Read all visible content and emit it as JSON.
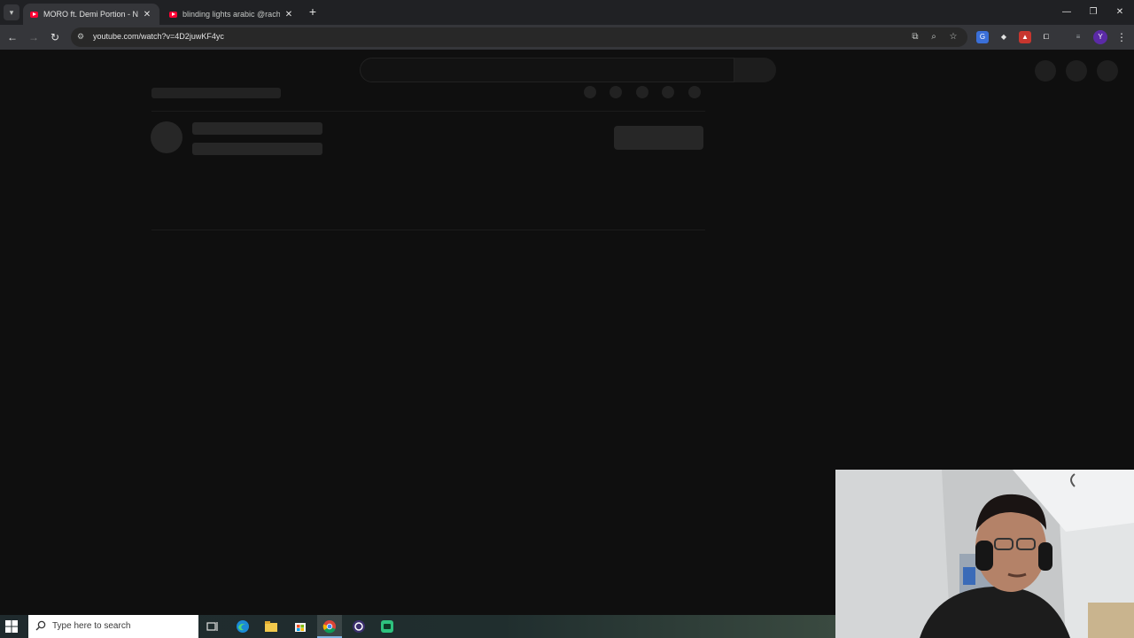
{
  "browser": {
    "tabs": [
      {
        "title": "MORO ft. Demi Portion - NINJA",
        "active": true,
        "close": "✕"
      },
      {
        "title": "blinding lights arabic @rachida",
        "active": false,
        "close": "✕"
      }
    ],
    "new_tab": "+",
    "window_controls": {
      "minimize": "—",
      "restore": "❐",
      "close": "✕"
    },
    "nav": {
      "back": "←",
      "forward": "→",
      "reload": "↻"
    },
    "url": "youtube.com/watch?v=4D2juwKF4yc",
    "profile_initial": "Y",
    "menu": "⋮"
  },
  "taskbar": {
    "search_placeholder": "Type here to search"
  },
  "colors": {
    "youtube_red": "#ff0033",
    "page_background": "#0f0f0f",
    "skeleton": "#272727"
  }
}
